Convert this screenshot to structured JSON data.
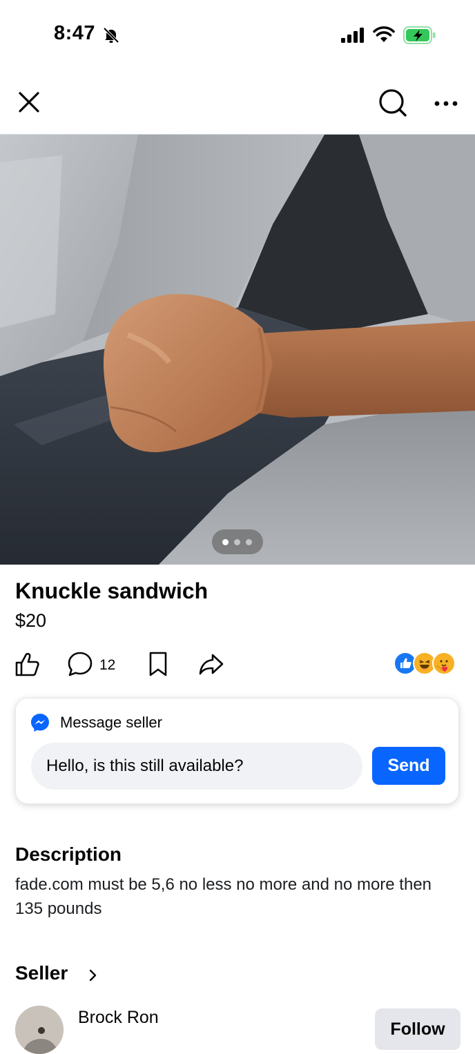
{
  "status_bar": {
    "time": "8:47",
    "icons": [
      "bell-off-icon",
      "cellular-signal-icon",
      "wifi-icon",
      "battery-charging-icon"
    ]
  },
  "nav": {
    "icons": [
      "close-icon",
      "search-icon",
      "more-icon"
    ]
  },
  "hero": {
    "page_count": 3,
    "active_page": 1
  },
  "listing": {
    "title": "Knuckle sandwich",
    "price": "$20",
    "comment_count": "12",
    "reactions": [
      "like",
      "haha",
      "care"
    ]
  },
  "message": {
    "label": "Message seller",
    "input_value": "Hello, is this still available?",
    "send_label": "Send"
  },
  "description": {
    "heading": "Description",
    "text": "fade.com must be 5,6 no less no more and no more then 135 pounds"
  },
  "seller": {
    "heading": "Seller",
    "name": "Brock Ron",
    "follow_label": "Follow"
  },
  "colors": {
    "accent": "#0866ff",
    "battery": "#34c759",
    "secondary_button": "#e4e6eb"
  }
}
